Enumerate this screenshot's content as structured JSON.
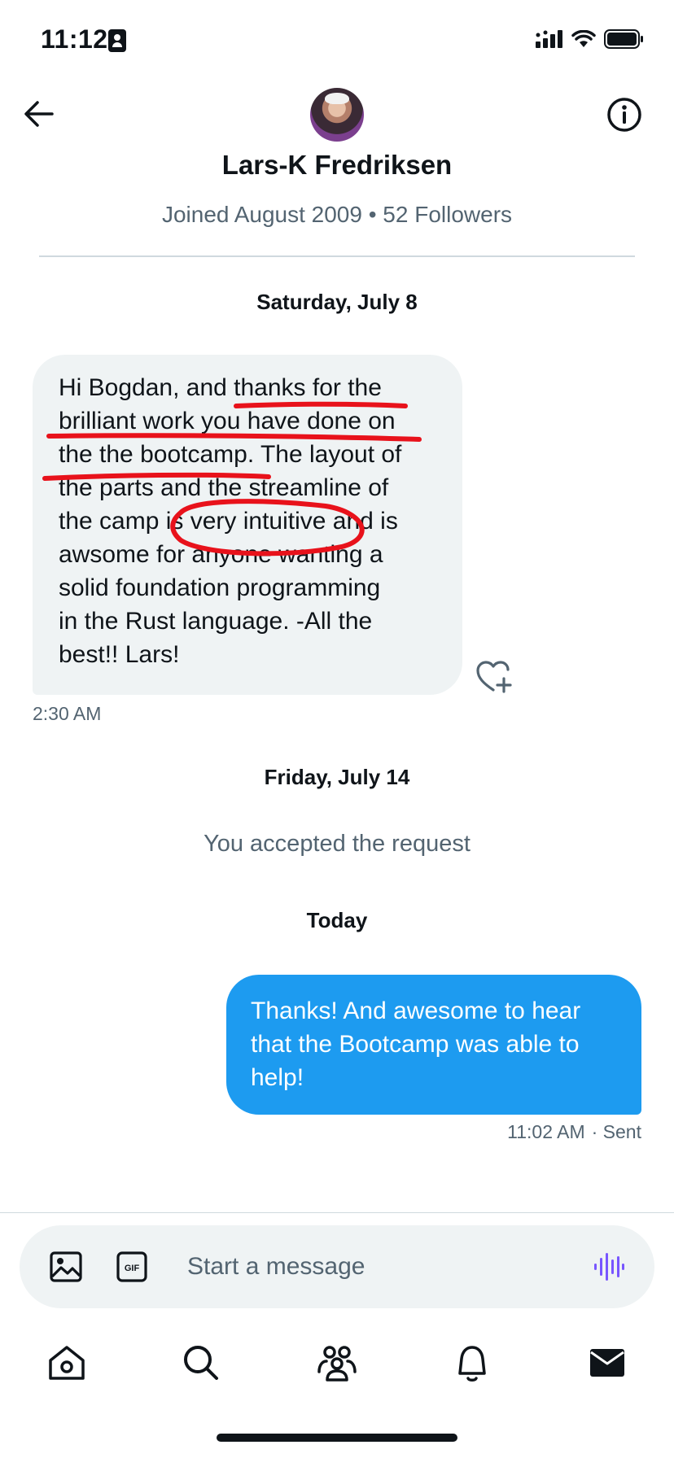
{
  "status_bar": {
    "time": "11:12",
    "icons": [
      "contact-badge-icon",
      "signal-icon",
      "wifi-icon",
      "battery-icon"
    ]
  },
  "header": {
    "back_icon": "arrow-left-icon",
    "info_icon": "info-icon",
    "name": "Lars-K Fredriksen",
    "meta": "Joined August 2009 • 52 Followers"
  },
  "conversation": {
    "date_1": "Saturday, July 8",
    "incoming_message": "Hi Bogdan, and thanks for the\nbrilliant work you have done on\nthe the bootcamp. The layout of\nthe parts and the streamline of\nthe camp is very intuitive and is\nawsome for anyone wanting a\nsolid foundation programming\nin the Rust language. -All the\nbest!! Lars!",
    "incoming_time": "2:30 AM",
    "date_2": "Friday, July 14",
    "system_message": "You accepted the request",
    "date_3": "Today",
    "outgoing_message": "Thanks! And awesome to hear\nthat the Bootcamp was able to\nhelp!",
    "outgoing_time": "11:02 AM",
    "outgoing_status": "· Sent"
  },
  "annotations": {
    "color": "#e8121b",
    "type": "hand-drawn underline and circle"
  },
  "composer": {
    "placeholder": "Start a message",
    "gif_label": "GIF"
  },
  "tab_bar": {
    "items": [
      "home-icon",
      "search-icon",
      "communities-icon",
      "notifications-icon",
      "messages-icon"
    ]
  },
  "colors": {
    "accent": "#1d9bf0",
    "incoming_bubble": "#eff3f4",
    "secondary_text": "#536471",
    "voice_accent": "#7856ff"
  }
}
